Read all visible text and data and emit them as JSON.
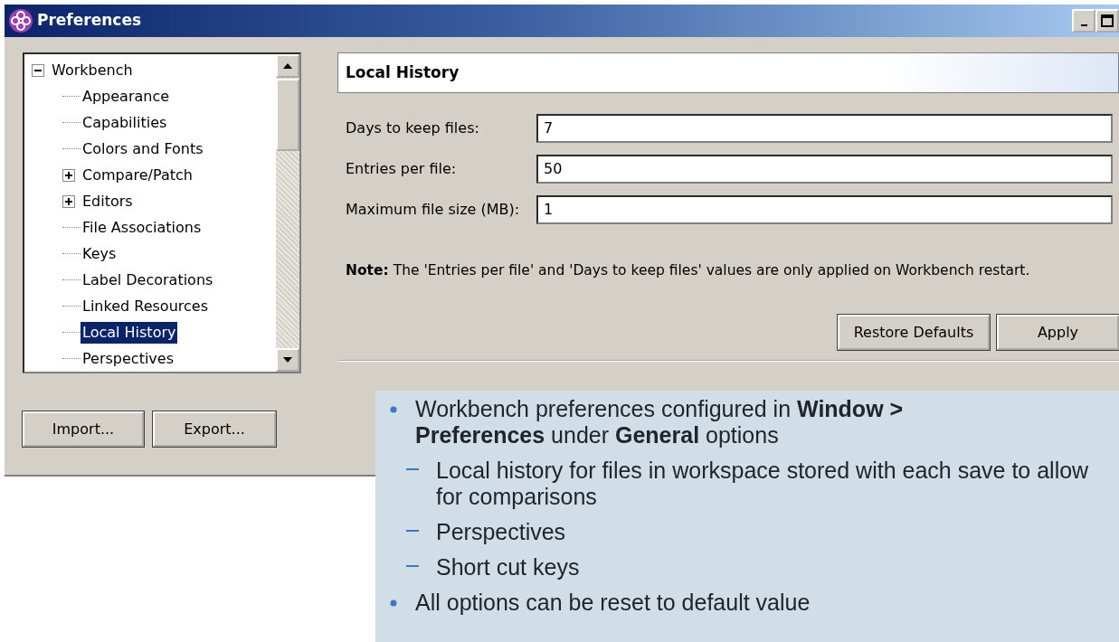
{
  "window": {
    "title": "Preferences"
  },
  "tree": [
    {
      "label": "Workbench",
      "kind": "branch",
      "expanded": true,
      "selected": false,
      "children": [
        {
          "label": "Appearance",
          "kind": "leaf",
          "selected": false
        },
        {
          "label": "Capabilities",
          "kind": "leaf",
          "selected": false
        },
        {
          "label": "Colors and Fonts",
          "kind": "leaf",
          "selected": false
        },
        {
          "label": "Compare/Patch",
          "kind": "branch",
          "expanded": false,
          "selected": false
        },
        {
          "label": "Editors",
          "kind": "branch",
          "expanded": false,
          "selected": false
        },
        {
          "label": "File Associations",
          "kind": "leaf",
          "selected": false
        },
        {
          "label": "Keys",
          "kind": "leaf",
          "selected": false
        },
        {
          "label": "Label Decorations",
          "kind": "leaf",
          "selected": false
        },
        {
          "label": "Linked Resources",
          "kind": "leaf",
          "selected": false
        },
        {
          "label": "Local History",
          "kind": "leaf",
          "selected": true
        },
        {
          "label": "Perspectives",
          "kind": "leaf",
          "selected": false
        }
      ]
    }
  ],
  "page": {
    "title": "Local History",
    "fields": [
      {
        "label": "Days to keep files:",
        "value": "7"
      },
      {
        "label": "Entries per file:",
        "value": "50"
      },
      {
        "label": "Maximum file size (MB):",
        "value": "1"
      }
    ],
    "note": "**Note:** The 'Entries per file' and 'Days to keep files' values are only applied on Workbench restart.",
    "buttons": [
      "Restore Defaults",
      "Apply"
    ]
  },
  "footer_buttons": [
    "Import...",
    "Export..."
  ],
  "callout": {
    "bullets": [
      {
        "text": "Workbench preferences configured in **Window > Preferences** under **General** options",
        "children": [
          {
            "text": "Local history for files in workspace stored with each save to allow for comparisons"
          },
          {
            "text": "Perspectives"
          },
          {
            "text": "Short cut keys"
          }
        ]
      },
      {
        "text": "All options can be reset to default value"
      }
    ]
  }
}
